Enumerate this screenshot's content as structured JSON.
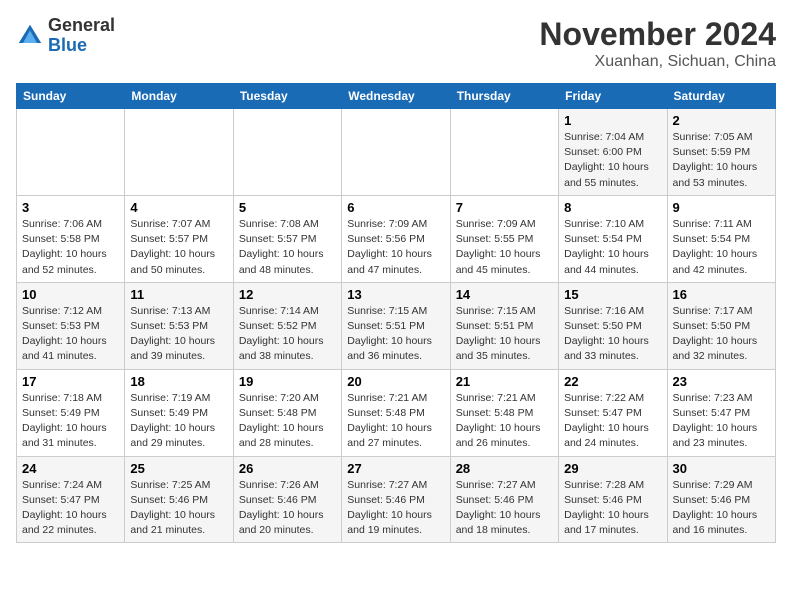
{
  "header": {
    "logo_general": "General",
    "logo_blue": "Blue",
    "month_title": "November 2024",
    "location": "Xuanhan, Sichuan, China"
  },
  "days_of_week": [
    "Sunday",
    "Monday",
    "Tuesday",
    "Wednesday",
    "Thursday",
    "Friday",
    "Saturday"
  ],
  "weeks": [
    [
      {
        "day": "",
        "info": ""
      },
      {
        "day": "",
        "info": ""
      },
      {
        "day": "",
        "info": ""
      },
      {
        "day": "",
        "info": ""
      },
      {
        "day": "",
        "info": ""
      },
      {
        "day": "1",
        "info": "Sunrise: 7:04 AM\nSunset: 6:00 PM\nDaylight: 10 hours and 55 minutes."
      },
      {
        "day": "2",
        "info": "Sunrise: 7:05 AM\nSunset: 5:59 PM\nDaylight: 10 hours and 53 minutes."
      }
    ],
    [
      {
        "day": "3",
        "info": "Sunrise: 7:06 AM\nSunset: 5:58 PM\nDaylight: 10 hours and 52 minutes."
      },
      {
        "day": "4",
        "info": "Sunrise: 7:07 AM\nSunset: 5:57 PM\nDaylight: 10 hours and 50 minutes."
      },
      {
        "day": "5",
        "info": "Sunrise: 7:08 AM\nSunset: 5:57 PM\nDaylight: 10 hours and 48 minutes."
      },
      {
        "day": "6",
        "info": "Sunrise: 7:09 AM\nSunset: 5:56 PM\nDaylight: 10 hours and 47 minutes."
      },
      {
        "day": "7",
        "info": "Sunrise: 7:09 AM\nSunset: 5:55 PM\nDaylight: 10 hours and 45 minutes."
      },
      {
        "day": "8",
        "info": "Sunrise: 7:10 AM\nSunset: 5:54 PM\nDaylight: 10 hours and 44 minutes."
      },
      {
        "day": "9",
        "info": "Sunrise: 7:11 AM\nSunset: 5:54 PM\nDaylight: 10 hours and 42 minutes."
      }
    ],
    [
      {
        "day": "10",
        "info": "Sunrise: 7:12 AM\nSunset: 5:53 PM\nDaylight: 10 hours and 41 minutes."
      },
      {
        "day": "11",
        "info": "Sunrise: 7:13 AM\nSunset: 5:53 PM\nDaylight: 10 hours and 39 minutes."
      },
      {
        "day": "12",
        "info": "Sunrise: 7:14 AM\nSunset: 5:52 PM\nDaylight: 10 hours and 38 minutes."
      },
      {
        "day": "13",
        "info": "Sunrise: 7:15 AM\nSunset: 5:51 PM\nDaylight: 10 hours and 36 minutes."
      },
      {
        "day": "14",
        "info": "Sunrise: 7:15 AM\nSunset: 5:51 PM\nDaylight: 10 hours and 35 minutes."
      },
      {
        "day": "15",
        "info": "Sunrise: 7:16 AM\nSunset: 5:50 PM\nDaylight: 10 hours and 33 minutes."
      },
      {
        "day": "16",
        "info": "Sunrise: 7:17 AM\nSunset: 5:50 PM\nDaylight: 10 hours and 32 minutes."
      }
    ],
    [
      {
        "day": "17",
        "info": "Sunrise: 7:18 AM\nSunset: 5:49 PM\nDaylight: 10 hours and 31 minutes."
      },
      {
        "day": "18",
        "info": "Sunrise: 7:19 AM\nSunset: 5:49 PM\nDaylight: 10 hours and 29 minutes."
      },
      {
        "day": "19",
        "info": "Sunrise: 7:20 AM\nSunset: 5:48 PM\nDaylight: 10 hours and 28 minutes."
      },
      {
        "day": "20",
        "info": "Sunrise: 7:21 AM\nSunset: 5:48 PM\nDaylight: 10 hours and 27 minutes."
      },
      {
        "day": "21",
        "info": "Sunrise: 7:21 AM\nSunset: 5:48 PM\nDaylight: 10 hours and 26 minutes."
      },
      {
        "day": "22",
        "info": "Sunrise: 7:22 AM\nSunset: 5:47 PM\nDaylight: 10 hours and 24 minutes."
      },
      {
        "day": "23",
        "info": "Sunrise: 7:23 AM\nSunset: 5:47 PM\nDaylight: 10 hours and 23 minutes."
      }
    ],
    [
      {
        "day": "24",
        "info": "Sunrise: 7:24 AM\nSunset: 5:47 PM\nDaylight: 10 hours and 22 minutes."
      },
      {
        "day": "25",
        "info": "Sunrise: 7:25 AM\nSunset: 5:46 PM\nDaylight: 10 hours and 21 minutes."
      },
      {
        "day": "26",
        "info": "Sunrise: 7:26 AM\nSunset: 5:46 PM\nDaylight: 10 hours and 20 minutes."
      },
      {
        "day": "27",
        "info": "Sunrise: 7:27 AM\nSunset: 5:46 PM\nDaylight: 10 hours and 19 minutes."
      },
      {
        "day": "28",
        "info": "Sunrise: 7:27 AM\nSunset: 5:46 PM\nDaylight: 10 hours and 18 minutes."
      },
      {
        "day": "29",
        "info": "Sunrise: 7:28 AM\nSunset: 5:46 PM\nDaylight: 10 hours and 17 minutes."
      },
      {
        "day": "30",
        "info": "Sunrise: 7:29 AM\nSunset: 5:46 PM\nDaylight: 10 hours and 16 minutes."
      }
    ]
  ]
}
